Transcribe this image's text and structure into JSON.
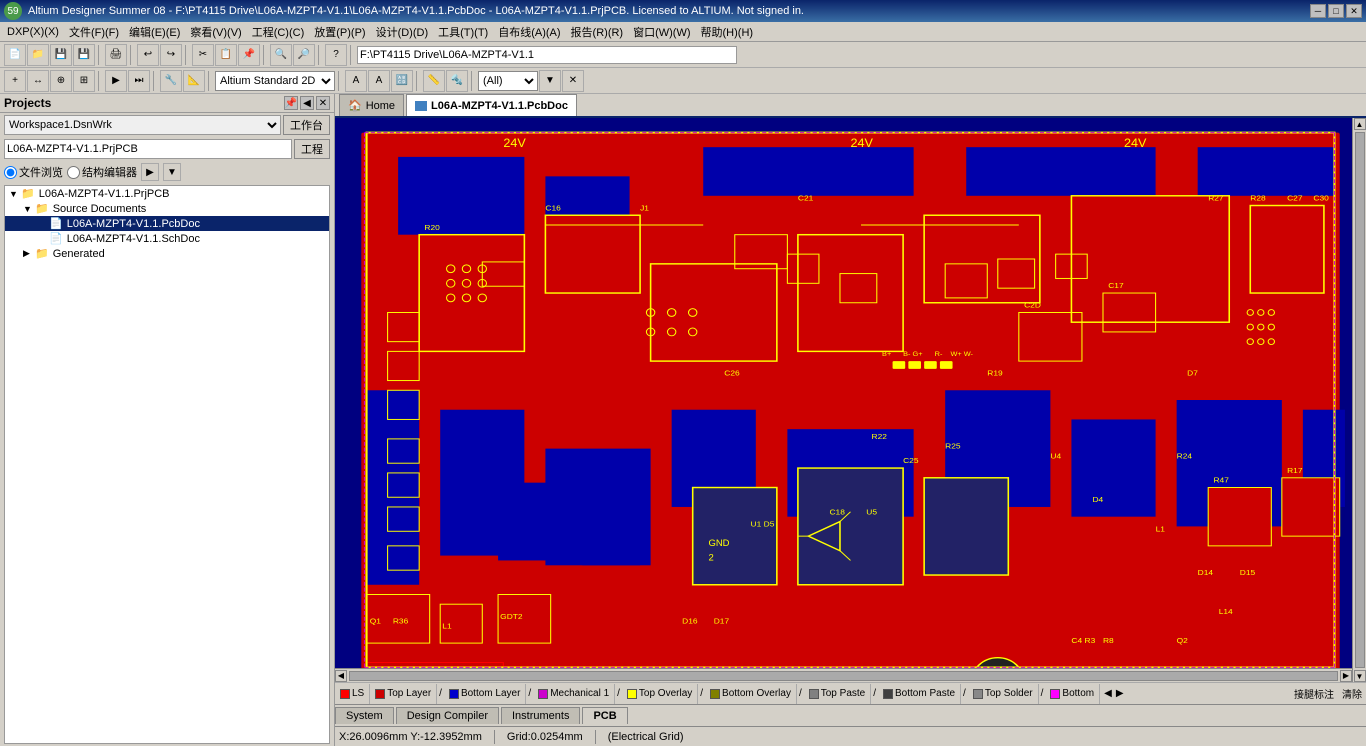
{
  "titlebar": {
    "text": "Altium Designer Summer 08 - F:\\PT4115 Drive\\L06A-MZPT4-V1.1\\L06A-MZPT4-V1.1.PcbDoc - L06A-MZPT4-V1.1.PrjPCB. Licensed to ALTIUM. Not signed in.",
    "badge": "59",
    "minimize": "─",
    "maximize": "□",
    "close": "✕"
  },
  "menubar": {
    "items": [
      "DXP(X)(X)",
      "文件(F)(F)",
      "编辑(E)(E)",
      "察看(V)(V)",
      "工程(C)(C)",
      "放置(P)(P)",
      "设计(D)(D)",
      "工具(T)(T)",
      "自布线(A)(A)",
      "报告(R)(R)",
      "窗口(W)(W)",
      "帮助(H)(H)"
    ]
  },
  "toolbar1": {
    "path_input": "F:\\PT4115 Drive\\L06A-MZPT4-V1.1"
  },
  "toolbar2": {
    "view_combo": "Altium Standard 2D",
    "filter_combo": "(All)"
  },
  "panel": {
    "title": "Projects",
    "workspace_label": "Workspace1.DsnWrk",
    "workspace_btn": "工作台",
    "project_value": "L06A-MZPT4-V1.1.PrjPCB",
    "project_btn": "工程",
    "view_mode1": "文件浏览",
    "view_mode2": "结构编辑器",
    "tree": [
      {
        "level": 0,
        "expand": "▼",
        "icon": "📁",
        "label": "L06A-MZPT4-V1.1.PrjPCB",
        "selected": false
      },
      {
        "level": 1,
        "expand": "▼",
        "icon": "📁",
        "label": "Source Documents",
        "selected": false
      },
      {
        "level": 2,
        "expand": "",
        "icon": "📄",
        "label": "L06A-MZPT4-V1.1.PcbDoc",
        "selected": true
      },
      {
        "level": 2,
        "expand": "",
        "icon": "📄",
        "label": "L06A-MZPT4-V1.1.SchDoc",
        "selected": false
      },
      {
        "level": 1,
        "expand": "▶",
        "icon": "📁",
        "label": "Generated",
        "selected": false
      }
    ]
  },
  "tabs": {
    "items": [
      {
        "label": "Home",
        "icon": "home",
        "active": false
      },
      {
        "label": "L06A-MZPT4-V1.1.PcbDoc",
        "icon": "pcb",
        "active": true
      }
    ]
  },
  "layer_tabs": [
    {
      "color": "#ff0000",
      "label": "LS",
      "active": false
    },
    {
      "color": "#cc0000",
      "label": "Top Layer",
      "active": false
    },
    {
      "color": "#0000cc",
      "label": "Bottom Layer",
      "active": false
    },
    {
      "color": "#cc00cc",
      "label": "Mechanical 1",
      "active": false
    },
    {
      "color": "#ffff00",
      "label": "Top Overlay",
      "active": false
    },
    {
      "color": "#888800",
      "label": "Bottom Overlay",
      "active": false
    },
    {
      "color": "#808080",
      "label": "Top Paste",
      "active": false
    },
    {
      "color": "#404040",
      "label": "Bottom Paste",
      "active": false
    },
    {
      "color": "#888888",
      "label": "Top Solder",
      "active": false
    },
    {
      "color": "#ff00ff",
      "label": "Bottom",
      "active": false
    }
  ],
  "bottom_tabs": [
    {
      "label": "System",
      "active": false
    },
    {
      "label": "Design Compiler",
      "active": false
    },
    {
      "label": "Instruments",
      "active": false
    },
    {
      "label": "PCB",
      "active": false
    }
  ],
  "statusbar": {
    "coords": "X:26.0096mm Y:-12.3952mm",
    "grid": "Grid:0.0254mm",
    "mode": "(Electrical Grid)"
  },
  "right_strip": {
    "labels": [
      "接腿标注",
      "清除"
    ]
  }
}
